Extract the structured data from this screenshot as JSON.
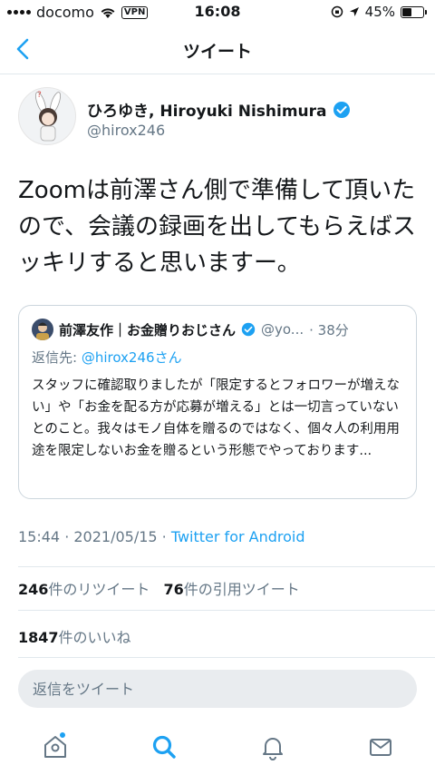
{
  "status_bar": {
    "carrier": "docomo",
    "vpn": "VPN",
    "time": "16:08",
    "battery": "45%",
    "battery_level": 0.45
  },
  "nav": {
    "title": "ツイート"
  },
  "tweet": {
    "display_name": "ひろゆき, Hiroyuki Nishimura",
    "handle": "@hirox246",
    "text": "Zoomは前澤さん側で準備して頂いたので、会議の録画を出してもらえばスッキリすると思いますー。",
    "timestamp": "15:44 · 2021/05/15 · ",
    "source": "Twitter for Android"
  },
  "quote": {
    "display_name": "前澤友作｜お金贈りおじさん",
    "handle": "@yo...",
    "age": "· 38分",
    "reply_prefix": "返信先: ",
    "reply_handle": "@hirox246さん",
    "text": "スタッフに確認取りましたが「限定するとフォロワーが増えない」や「お金を配る方が応募が増える」とは一切言っていないとのこと。我々はモノ自体を贈るのではなく、個々人の利用用途を限定しないお金を贈るという形態でやっております..."
  },
  "stats": {
    "retweets": "246",
    "retweets_label": "件のリツイート",
    "quotes": "76",
    "quotes_label": "件の引用ツイート",
    "likes": "1847",
    "likes_label": "件のいいね"
  },
  "reply": {
    "placeholder": "返信をツイート"
  },
  "colors": {
    "accent": "#1da1f2",
    "secondary_text": "#657786",
    "divider": "#e1e8ed"
  },
  "tabs": [
    "home-icon",
    "search-icon",
    "notifications-icon",
    "messages-icon"
  ]
}
